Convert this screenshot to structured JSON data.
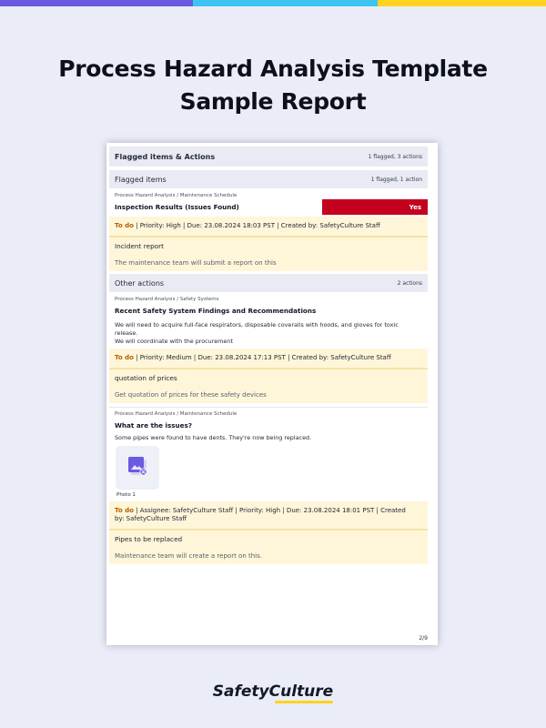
{
  "colors": {
    "bar_purple": "#6a5ae0",
    "bar_blue": "#3dc4f2",
    "bar_yellow": "#ffd21f",
    "flag_red": "#c4001e",
    "todo_orange": "#b35f00"
  },
  "headline": {
    "line1": "Process Hazard Analysis Template",
    "line2": "Sample Report"
  },
  "report": {
    "header": {
      "title": "Flagged items & Actions",
      "count": "1 flagged, 3 actions"
    },
    "flagged": {
      "title": "Flagged items",
      "count": "1 flagged, 1 action",
      "item": {
        "breadcrumb": "Process Hazard Analysis / Maintenance Schedule",
        "question": "Inspection Results (Issues Found)",
        "answer": "Yes",
        "action": {
          "status": "To do",
          "meta": "  |  Priority: High  |  Due: 23.08.2024 18:03 PST  |  Created by: SafetyCulture Staff",
          "title": "Incident report",
          "description": "The maintenance team will submit a report on this"
        }
      }
    },
    "other": {
      "title": "Other actions",
      "count": "2 actions",
      "item1": {
        "breadcrumb": "Process Hazard Analysis / Safety Systems",
        "question": "Recent Safety System Findings and Recommendations",
        "text_line1": "We will need to acquire full-face respirators, disposable coveralls with hoods, and gloves for toxic release.",
        "text_line2": "We will coordinate with the procurement",
        "action": {
          "status": "To do",
          "meta": "  |  Priority: Medium  |  Due: 23.08.2024 17:13 PST  |  Created by: SafetyCulture Staff",
          "title": "quotation of prices",
          "description": "Get quotation of prices for these safety devices"
        }
      },
      "item2": {
        "breadcrumb": "Process Hazard Analysis / Maintenance Schedule",
        "question": "What are the issues?",
        "text": "Some pipes were found to have dents. They're now being replaced.",
        "photo_label": "Photo 1",
        "action": {
          "status": "To do",
          "meta_line1": "  |  Assignee: SafetyCulture Staff  |  Priority: High  |  Due: 23.08.2024 18:01 PST  |  Created",
          "meta_line2": "by: SafetyCulture Staff",
          "title": "Pipes to be replaced",
          "description": "Maintenance team will create a report on this."
        }
      }
    },
    "page_number": "2/9"
  },
  "brand": {
    "part1": "Safety",
    "part2": "Culture"
  },
  "icons": {
    "photo": "image-broken-icon"
  }
}
